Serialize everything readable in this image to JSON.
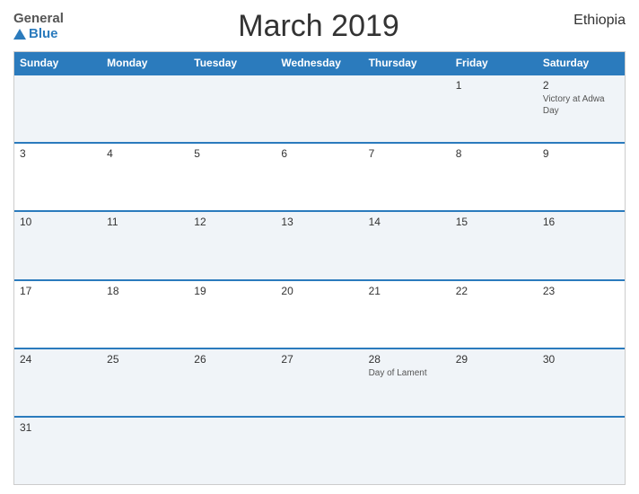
{
  "header": {
    "logo_general": "General",
    "logo_blue": "Blue",
    "title": "March 2019",
    "country": "Ethiopia"
  },
  "days_of_week": [
    "Sunday",
    "Monday",
    "Tuesday",
    "Wednesday",
    "Thursday",
    "Friday",
    "Saturday"
  ],
  "weeks": [
    [
      {
        "day": "",
        "holiday": ""
      },
      {
        "day": "",
        "holiday": ""
      },
      {
        "day": "",
        "holiday": ""
      },
      {
        "day": "",
        "holiday": ""
      },
      {
        "day": "",
        "holiday": ""
      },
      {
        "day": "1",
        "holiday": ""
      },
      {
        "day": "2",
        "holiday": "Victory at Adwa Day"
      }
    ],
    [
      {
        "day": "3",
        "holiday": ""
      },
      {
        "day": "4",
        "holiday": ""
      },
      {
        "day": "5",
        "holiday": ""
      },
      {
        "day": "6",
        "holiday": ""
      },
      {
        "day": "7",
        "holiday": ""
      },
      {
        "day": "8",
        "holiday": ""
      },
      {
        "day": "9",
        "holiday": ""
      }
    ],
    [
      {
        "day": "10",
        "holiday": ""
      },
      {
        "day": "11",
        "holiday": ""
      },
      {
        "day": "12",
        "holiday": ""
      },
      {
        "day": "13",
        "holiday": ""
      },
      {
        "day": "14",
        "holiday": ""
      },
      {
        "day": "15",
        "holiday": ""
      },
      {
        "day": "16",
        "holiday": ""
      }
    ],
    [
      {
        "day": "17",
        "holiday": ""
      },
      {
        "day": "18",
        "holiday": ""
      },
      {
        "day": "19",
        "holiday": ""
      },
      {
        "day": "20",
        "holiday": ""
      },
      {
        "day": "21",
        "holiday": ""
      },
      {
        "day": "22",
        "holiday": ""
      },
      {
        "day": "23",
        "holiday": ""
      }
    ],
    [
      {
        "day": "24",
        "holiday": ""
      },
      {
        "day": "25",
        "holiday": ""
      },
      {
        "day": "26",
        "holiday": ""
      },
      {
        "day": "27",
        "holiday": ""
      },
      {
        "day": "28",
        "holiday": "Day of Lament"
      },
      {
        "day": "29",
        "holiday": ""
      },
      {
        "day": "30",
        "holiday": ""
      }
    ],
    [
      {
        "day": "31",
        "holiday": ""
      },
      {
        "day": "",
        "holiday": ""
      },
      {
        "day": "",
        "holiday": ""
      },
      {
        "day": "",
        "holiday": ""
      },
      {
        "day": "",
        "holiday": ""
      },
      {
        "day": "",
        "holiday": ""
      },
      {
        "day": "",
        "holiday": ""
      }
    ]
  ]
}
